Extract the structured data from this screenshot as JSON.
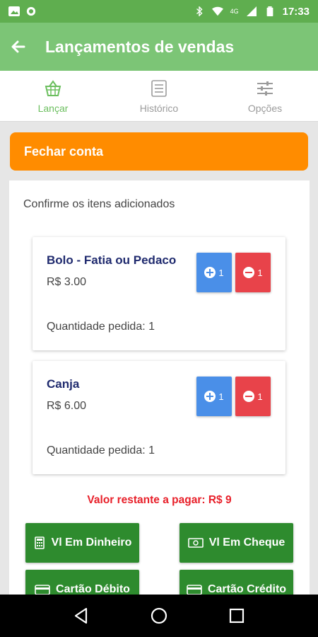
{
  "status_bar": {
    "time": "17:33",
    "network": "4G"
  },
  "app_bar": {
    "title": "Lançamentos de vendas"
  },
  "tabs": [
    {
      "label": "Lançar",
      "icon": "basket-icon",
      "active": true
    },
    {
      "label": "Histórico",
      "icon": "list-icon",
      "active": false
    },
    {
      "label": "Opções",
      "icon": "sliders-icon",
      "active": false
    }
  ],
  "fechar_conta": "Fechar conta",
  "confirm_text": "Confirme os itens adicionados",
  "items": [
    {
      "name": "Bolo - Fatia ou Pedaco",
      "price": "R$ 3.00",
      "plus_label": "1",
      "minus_label": "1",
      "qty_text": "Quantidade pedida: 1"
    },
    {
      "name": "Canja",
      "price": "R$ 6.00",
      "plus_label": "1",
      "minus_label": "1",
      "qty_text": "Quantidade pedida: 1"
    }
  ],
  "valor_restante": "Valor restante a pagar: R$ 9",
  "payment_buttons": [
    {
      "label": "Vl Em Dinheiro",
      "icon": "calculator-icon"
    },
    {
      "label": "Vl Em Cheque",
      "icon": "cash-icon"
    },
    {
      "label": "Cartão Débito",
      "icon": "credit-card-icon"
    },
    {
      "label": "Cartão Crédito",
      "icon": "credit-card-icon"
    }
  ],
  "colors": {
    "app_bar": "#7cc576",
    "status_bar": "#5fae4f",
    "accent_orange": "#ff8c00",
    "pay_green": "#2e8b2e",
    "plus_blue": "#4a8fe8",
    "minus_red": "#e8434a",
    "alert_red": "#e8202a"
  }
}
